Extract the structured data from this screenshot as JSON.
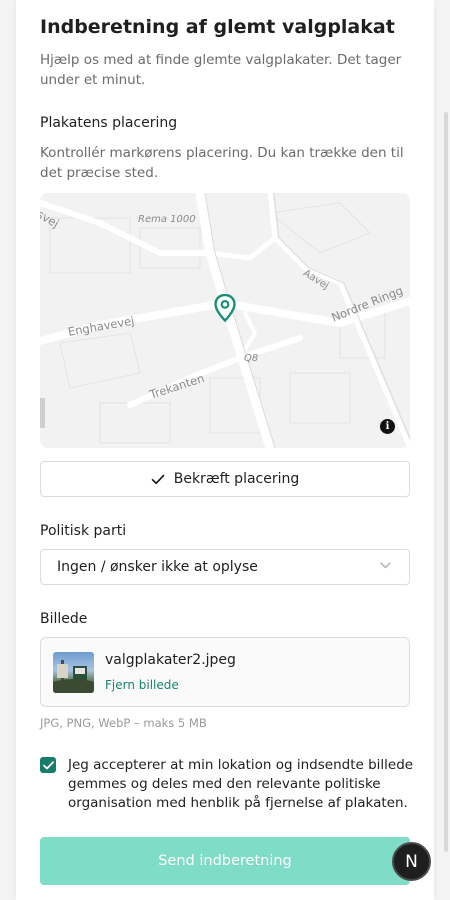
{
  "form": {
    "title": "Indberetning af glemt valgplakat",
    "subtitle": "Hjælp os med at finde glemte valgplakater. Det tager under et minut."
  },
  "location": {
    "label": "Plakatens placering",
    "help": "Kontrollér markørens placering. Du kan trække den til det præcise sted.",
    "map_streets": [
      "Rema 1000",
      "Enghavevej",
      "Aavej",
      "Nordre Ringg",
      "Q8",
      "Trekanten",
      "svej"
    ],
    "info_icon": "info-icon",
    "pin_icon": "location-pin-icon",
    "confirm_label": "Bekræft placering"
  },
  "party": {
    "label": "Politisk parti",
    "selected": "Ingen / ønsker ikke at oplyse"
  },
  "image": {
    "label": "Billede",
    "file_name": "valgplakater2.jpeg",
    "remove_label": "Fjern billede",
    "hint": "JPG, PNG, WebP – maks 5 MB"
  },
  "consent": {
    "checked": true,
    "text": "Jeg accepterer at min lokation og indsendte billede gemmes og deles med den relevante politiske organisation med henblik på fjernelse af plakaten."
  },
  "submit_label": "Send indberetning",
  "fab_label": "N",
  "colors": {
    "accent": "#197c6b",
    "submit_disabled": "#7fdcc7",
    "link": "#17856f"
  }
}
